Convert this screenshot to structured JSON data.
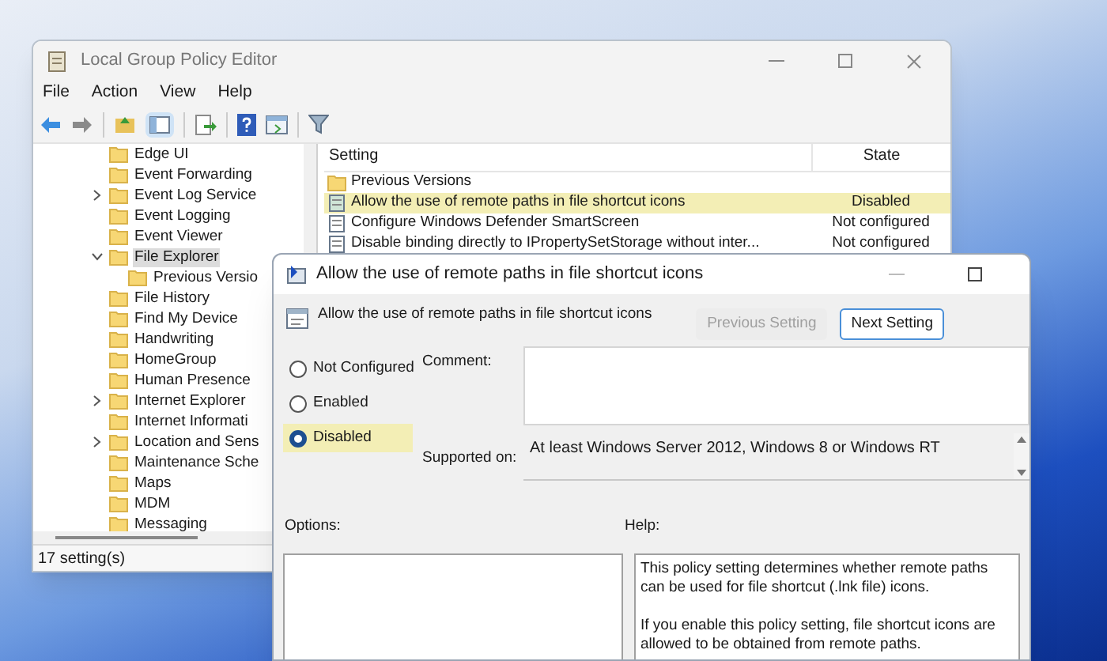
{
  "main_window": {
    "title": "Local Group Policy Editor",
    "menu": [
      "File",
      "Action",
      "View",
      "Help"
    ],
    "tree": [
      {
        "label": "Edge UI"
      },
      {
        "label": "Event Forwarding"
      },
      {
        "label": "Event Log Service",
        "expanded": false
      },
      {
        "label": "Event Logging"
      },
      {
        "label": "Event Viewer"
      },
      {
        "label": "File Explorer",
        "expanded": true,
        "selected": true,
        "children": [
          {
            "label": "Previous Versio"
          }
        ]
      },
      {
        "label": "File History"
      },
      {
        "label": "Find My Device"
      },
      {
        "label": "Handwriting"
      },
      {
        "label": "HomeGroup"
      },
      {
        "label": "Human Presence"
      },
      {
        "label": "Internet Explorer",
        "expanded": false
      },
      {
        "label": "Internet Informati"
      },
      {
        "label": "Location and Sens",
        "expanded": false
      },
      {
        "label": "Maintenance Sche"
      },
      {
        "label": "Maps"
      },
      {
        "label": "MDM"
      },
      {
        "label": "Messaging"
      }
    ],
    "list": {
      "columns": [
        "Setting",
        "State"
      ],
      "rows": [
        {
          "kind": "folder",
          "setting": "Previous Versions",
          "selected": false
        },
        {
          "kind": "policy",
          "setting": "Allow the use of remote paths in file shortcut icons",
          "state": "Disabled",
          "selected": true
        },
        {
          "kind": "policy",
          "setting": "Configure Windows Defender SmartScreen",
          "state": "Not configured",
          "selected": false
        },
        {
          "kind": "policy",
          "setting": "Disable binding directly to IPropertySetStorage without inter...",
          "state": "Not configured",
          "selected": false
        }
      ]
    },
    "status_bar": "17 setting(s)"
  },
  "dialog": {
    "title": "Allow the use of remote paths in file shortcut icons",
    "heading": "Allow the use of remote paths in file shortcut icons",
    "buttons": [
      {
        "label": "Previous Setting",
        "disabled": true
      },
      {
        "label": "Next Setting",
        "disabled": false
      }
    ],
    "options": [
      {
        "label": "Not Configured",
        "selected": false
      },
      {
        "label": "Enabled",
        "selected": false
      },
      {
        "label": "Disabled",
        "selected": true
      }
    ],
    "comment_label": "Comment:",
    "supported_label": "Supported on:",
    "supported_text": "At least Windows Server 2012, Windows 8 or Windows RT",
    "options_label": "Options:",
    "help_label": "Help:",
    "help_text": [
      "This policy setting determines whether remote paths can be used for file shortcut (.lnk file) icons.",
      "If you enable this policy setting, file shortcut icons are allowed to be obtained from remote paths."
    ]
  }
}
